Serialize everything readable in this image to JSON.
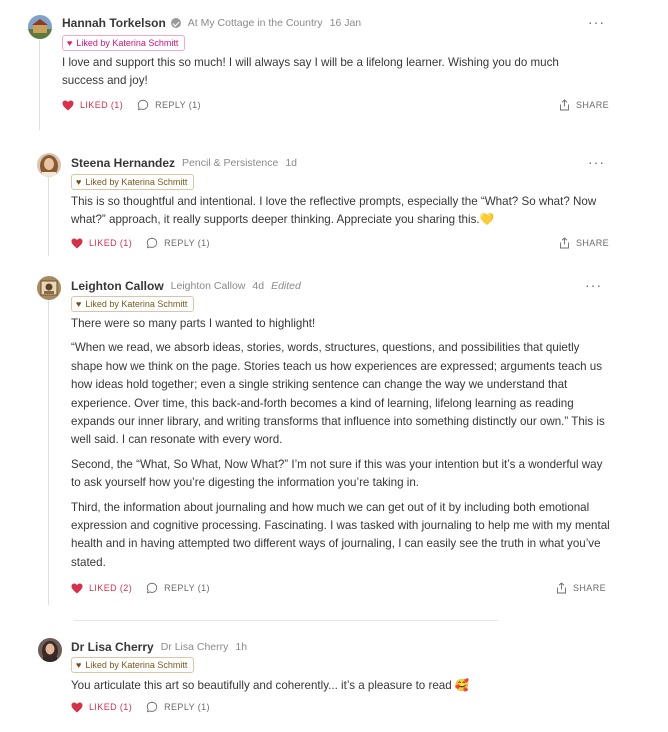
{
  "comments": [
    {
      "author": "Hannah Torkelson",
      "publication": "At My Cottage in the Country",
      "date": "16 Jan",
      "edited": "",
      "verified": true,
      "badge": "Liked by Katerina Schmitt",
      "paragraphs": [
        "I love and support this so much! I will always say I will be a lifelong learner. Wishing you do much success and joy!"
      ],
      "liked_label": "LIKED (1)",
      "reply_label": "REPLY (1)",
      "share_label": "SHARE"
    },
    {
      "author": "Steena Hernandez",
      "publication": "Pencil & Persistence",
      "date": "1d",
      "edited": "",
      "badge": "Liked by Katerina Schmitt",
      "paragraphs": [
        "This is so thoughtful and intentional. I love the reflective prompts, especially the “What? So what? Now what?” approach, it really supports deeper thinking. Appreciate you sharing this.💛"
      ],
      "liked_label": "LIKED (1)",
      "reply_label": "REPLY (1)",
      "share_label": "SHARE"
    },
    {
      "author": "Leighton Callow",
      "publication": "Leighton Callow",
      "date": "4d",
      "edited": "Edited",
      "badge": "Liked by Katerina Schmitt",
      "paragraphs": [
        "There were so many parts I wanted to highlight!",
        "“When we read, we absorb ideas, stories, words, structures, questions, and possibilities that quietly shape how we think on the page. Stories teach us how experiences are expressed; arguments teach us how ideas hold together; even a single striking sentence can change the way we understand that experience. Over time, this back-and-forth becomes a kind of learning, lifelong learning as reading expands our inner library, and writing transforms that influence into something distinctly our own.” This is well said. I can resonate with every word.",
        "Second, the “What, So What, Now What?” I’m not sure if this was your intention but it’s a wonderful way to ask yourself how you’re digesting the information you’re taking in.",
        "Third, the information about journaling and how much we can get out of it by including both emotional expression and cognitive processing. Fascinating. I was tasked with journaling to help me with my mental health and in having attempted two different ways of journaling, I can easily see the truth in what you’ve stated."
      ],
      "liked_label": "LIKED (2)",
      "reply_label": "REPLY (1)",
      "share_label": "SHARE"
    },
    {
      "author": "Dr Lisa Cherry",
      "publication": "Dr Lisa Cherry",
      "date": "1h",
      "edited": "",
      "badge": "Liked by Katerina Schmitt",
      "paragraphs": [
        "You articulate this art so beautifully and coherently... it’s a pleasure to read 🥰"
      ],
      "liked_label": "LIKED (1)",
      "reply_label": "REPLY (1)",
      "share_label": ""
    }
  ],
  "more_label": "···",
  "colors": {
    "liked": "#d6304a",
    "badge_pink": "#d4127a",
    "badge_brown": "#7a5a1f",
    "muted": "#8a8a8a"
  },
  "icons": [
    "verified-icon",
    "heart-icon",
    "reply-icon",
    "share-icon",
    "more-icon"
  ]
}
